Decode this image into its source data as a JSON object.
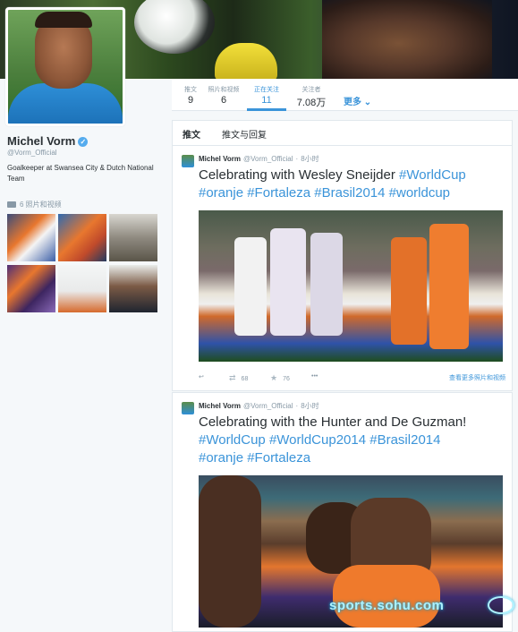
{
  "nav": {
    "items": [
      {
        "label": "推文",
        "value": "9"
      },
      {
        "label": "照片和视频",
        "value": "6"
      },
      {
        "label": "正在关注",
        "value": "11"
      },
      {
        "label": "关注者",
        "value": "7.08万"
      }
    ],
    "more": "更多"
  },
  "profile": {
    "name": "Michel Vorm",
    "handle": "@Vorm_Official",
    "bio": "Goalkeeper at Swansea City & Dutch National Team",
    "photos_link": "6 照片和视频"
  },
  "tabs": [
    "推文",
    "推文与回复"
  ],
  "tweets": [
    {
      "name": "Michel Vorm",
      "handle": "@Vorm_Official",
      "time": "8小时",
      "text_plain": "Celebrating with Wesley Sneijder ",
      "tags": [
        "#WorldCup",
        "#oranje",
        "#Fortaleza",
        "#Brasil2014",
        "#worldcup"
      ],
      "retweets": "68",
      "favorites": "76",
      "more_dots": "•••",
      "see_more": "查看更多照片和视频"
    },
    {
      "name": "Michel Vorm",
      "handle": "@Vorm_Official",
      "time": "8小时",
      "text_plain": "Celebrating with the Hunter and De Guzman!",
      "tags": [
        "#WorldCup",
        "#WorldCup2014",
        "#Brasil2014",
        "#oranje",
        "#Fortaleza"
      ]
    }
  ],
  "watermark": "sports.sohu.com",
  "colors": {
    "accent": "#3b94d9",
    "muted": "#8899a6",
    "text": "#292f33"
  },
  "icons": [
    "verified-icon",
    "camera-icon",
    "reply-icon",
    "retweet-icon",
    "favorite-icon",
    "more-icon",
    "chevron-down-icon"
  ]
}
